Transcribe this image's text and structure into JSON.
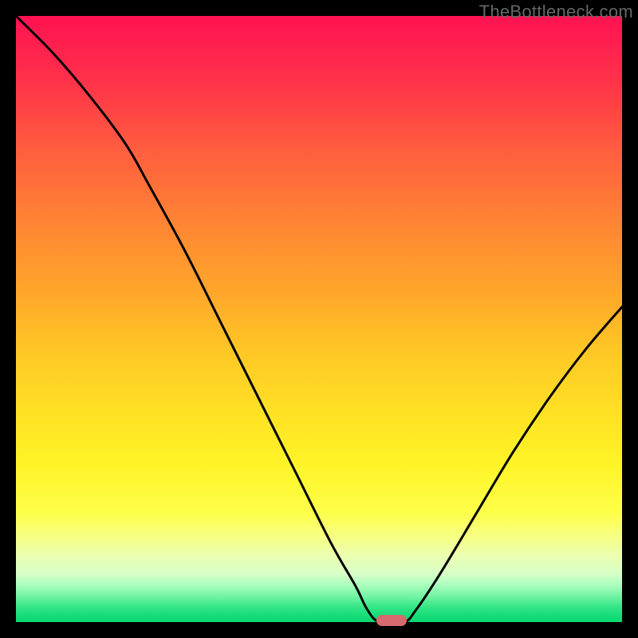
{
  "watermark": "TheBottleneck.com",
  "chart_data": {
    "type": "line",
    "title": "",
    "xlabel": "",
    "ylabel": "",
    "xlim": [
      0,
      100
    ],
    "ylim": [
      0,
      100
    ],
    "notch_x": 62,
    "notch_y": 0,
    "curve_points": [
      {
        "x": 0,
        "y": 100
      },
      {
        "x": 6,
        "y": 94
      },
      {
        "x": 12,
        "y": 87
      },
      {
        "x": 18,
        "y": 79
      },
      {
        "x": 22,
        "y": 72
      },
      {
        "x": 28,
        "y": 61
      },
      {
        "x": 34,
        "y": 49
      },
      {
        "x": 40,
        "y": 37
      },
      {
        "x": 46,
        "y": 25
      },
      {
        "x": 52,
        "y": 13
      },
      {
        "x": 56,
        "y": 6
      },
      {
        "x": 58,
        "y": 2
      },
      {
        "x": 60,
        "y": 0
      },
      {
        "x": 64,
        "y": 0
      },
      {
        "x": 66,
        "y": 2
      },
      {
        "x": 70,
        "y": 8
      },
      {
        "x": 76,
        "y": 18
      },
      {
        "x": 82,
        "y": 28
      },
      {
        "x": 88,
        "y": 37
      },
      {
        "x": 94,
        "y": 45
      },
      {
        "x": 100,
        "y": 52
      }
    ],
    "marker": {
      "x": 62,
      "y": 0,
      "color": "#d76a6e"
    },
    "gradient_stops": [
      {
        "pos": 0,
        "color": "#ff1252"
      },
      {
        "pos": 0.25,
        "color": "#ff7a36"
      },
      {
        "pos": 0.55,
        "color": "#ffd025"
      },
      {
        "pos": 0.8,
        "color": "#fdff3b"
      },
      {
        "pos": 0.92,
        "color": "#ddffc0"
      },
      {
        "pos": 1.0,
        "color": "#0bd870"
      }
    ]
  }
}
